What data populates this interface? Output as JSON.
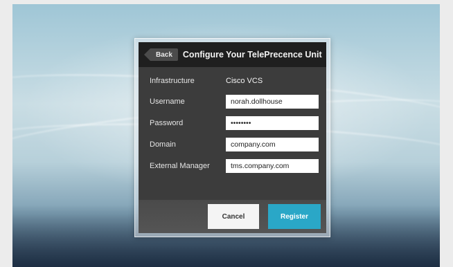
{
  "dialog": {
    "back_label": "Back",
    "title": "Configure Your TelePrecence Unit"
  },
  "fields": {
    "infrastructure": {
      "label": "Infrastructure",
      "value": "Cisco VCS"
    },
    "username": {
      "label": "Username",
      "value": "norah.dollhouse"
    },
    "password": {
      "label": "Password",
      "value": "••••••••"
    },
    "domain": {
      "label": "Domain",
      "value": "company.com"
    },
    "external_manager": {
      "label": "External Manager",
      "value": "tms.company.com"
    }
  },
  "actions": {
    "cancel_label": "Cancel",
    "register_label": "Register"
  },
  "colors": {
    "accent": "#2aa7c7",
    "panel": "#3c3c3c",
    "title_bar": "#1f1f1f"
  }
}
